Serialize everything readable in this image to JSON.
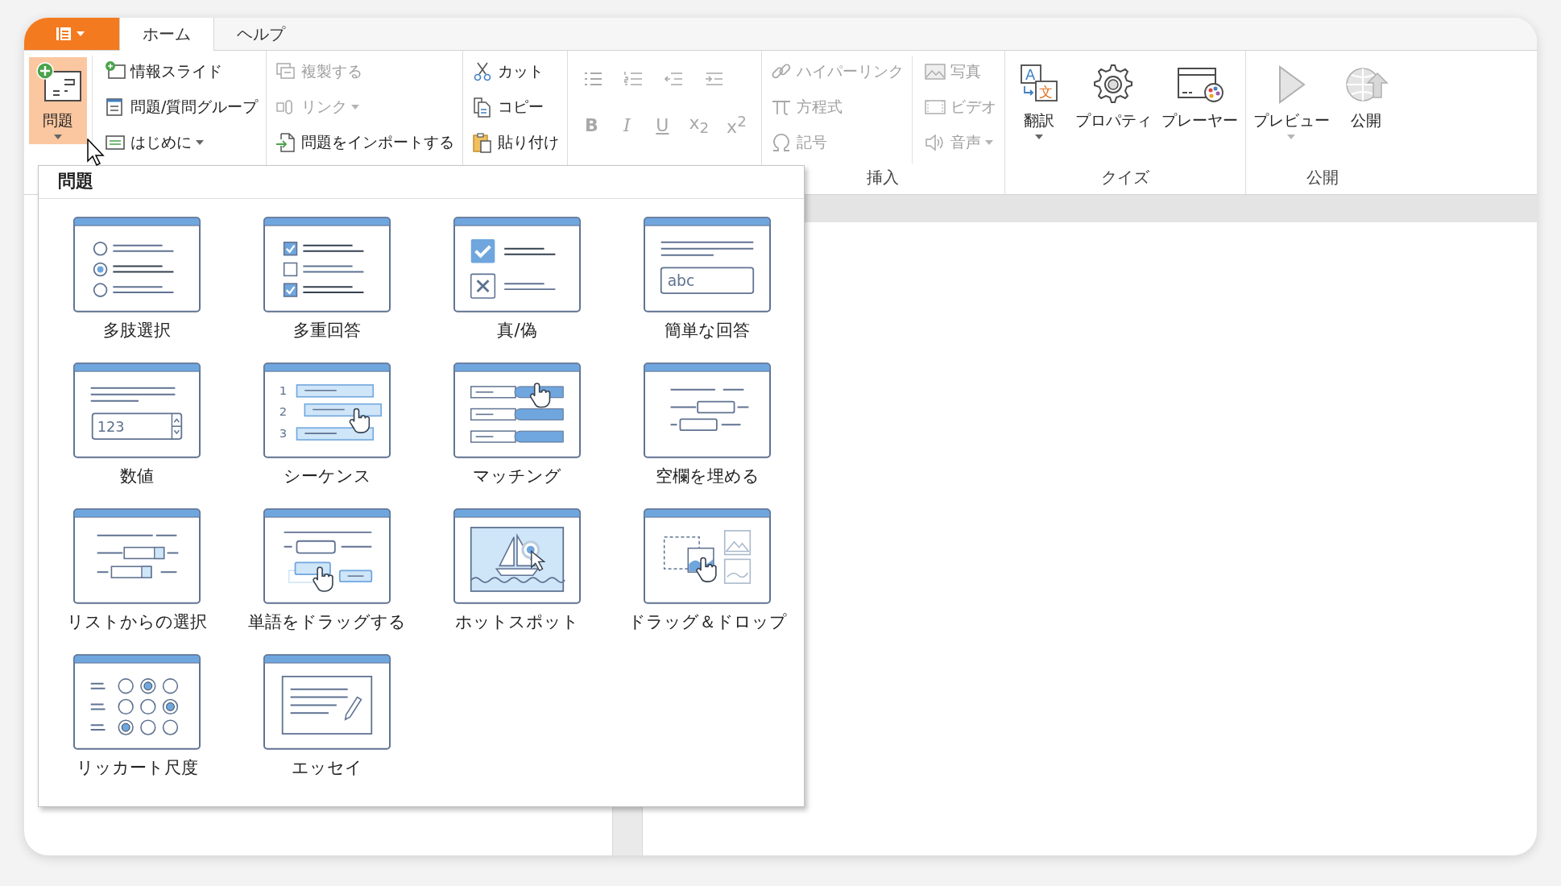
{
  "tabs": [
    {
      "label": "ホーム",
      "selected": true
    },
    {
      "label": "ヘルプ",
      "selected": false
    }
  ],
  "ribbon": {
    "groups": [
      {
        "items": [
          {
            "kind": "large",
            "label": "問題",
            "dropdown": true,
            "pressed": true,
            "disabled": false
          },
          {
            "kind": "small",
            "label": "情報スライド",
            "dropdown": false,
            "disabled": false
          },
          {
            "kind": "small",
            "label": "問題/質問グループ",
            "dropdown": false,
            "disabled": false
          },
          {
            "kind": "small",
            "label": "はじめに",
            "dropdown": true,
            "disabled": false
          }
        ]
      },
      {
        "items": [
          {
            "kind": "small",
            "label": "複製する",
            "dropdown": false,
            "disabled": true
          },
          {
            "kind": "small",
            "label": "リンク",
            "dropdown": true,
            "disabled": true
          },
          {
            "kind": "small",
            "label": "問題をインポートする",
            "dropdown": false,
            "disabled": false
          }
        ]
      },
      {
        "items": [
          {
            "kind": "small",
            "label": "カット",
            "dropdown": false,
            "disabled": false
          },
          {
            "kind": "small",
            "label": "コピー",
            "dropdown": false,
            "disabled": false
          },
          {
            "kind": "small",
            "label": "貼り付け",
            "dropdown": false,
            "disabled": false
          }
        ]
      },
      {
        "rows": [
          [
            {
              "kind": "tool",
              "disabled": true
            },
            {
              "kind": "tool",
              "disabled": true
            },
            {
              "kind": "tool",
              "disabled": true
            },
            {
              "kind": "tool",
              "disabled": true
            }
          ],
          [
            {
              "kind": "tool",
              "label": "B",
              "disabled": true
            },
            {
              "kind": "tool",
              "label": "I",
              "disabled": true
            },
            {
              "kind": "tool",
              "label": "U",
              "disabled": true
            },
            {
              "kind": "tool",
              "label": "x$_{2}$",
              "disabled": true
            },
            {
              "kind": "tool",
              "label": "x$^{2}$",
              "disabled": true
            }
          ]
        ]
      },
      {
        "label": "挿入",
        "items": [
          {
            "kind": "small",
            "label": "ハイパーリンク",
            "dropdown": false,
            "disabled": true
          },
          {
            "kind": "small",
            "label": "方程式",
            "dropdown": false,
            "disabled": true
          },
          {
            "kind": "small",
            "label": "記号",
            "dropdown": false,
            "disabled": true
          },
          {
            "kind": "small",
            "label": "写真",
            "dropdown": false,
            "disabled": true
          },
          {
            "kind": "small",
            "label": "ビデオ",
            "dropdown": false,
            "disabled": true
          },
          {
            "kind": "small",
            "label": "音声",
            "dropdown": true,
            "disabled": true
          }
        ]
      },
      {
        "label": "クイズ",
        "items": [
          {
            "kind": "large",
            "label": "翻訳",
            "icon_text": [
              "A",
              "文"
            ],
            "dropdown": true,
            "pressed": false,
            "disabled": false
          },
          {
            "kind": "large",
            "label": "プロパティ",
            "dropdown": false,
            "pressed": false,
            "disabled": false
          },
          {
            "kind": "large",
            "label": "プレーヤー",
            "dropdown": false,
            "pressed": false,
            "disabled": false
          }
        ]
      },
      {
        "label": "公開",
        "items": [
          {
            "kind": "large",
            "label": "プレビュー",
            "dropdown": true,
            "pressed": false,
            "disabled": true
          },
          {
            "kind": "large",
            "label": "公開",
            "dropdown": false,
            "pressed": false,
            "disabled": true
          }
        ]
      }
    ]
  },
  "dropdown": {
    "title": "問題",
    "items": [
      {
        "label": "多肢選択"
      },
      {
        "label": "多重回答"
      },
      {
        "label": "真/偽"
      },
      {
        "label": "簡単な回答",
        "sample": "abc"
      },
      {
        "label": "数値",
        "sample": "123"
      },
      {
        "label": "シーケンス",
        "markers": [
          "1",
          "2",
          "3"
        ]
      },
      {
        "label": "マッチング"
      },
      {
        "label": "空欄を埋める"
      },
      {
        "label": "リストからの選択"
      },
      {
        "label": "単語をドラッグする"
      },
      {
        "label": "ホットスポット"
      },
      {
        "label": "ドラッグ＆ドロップ"
      },
      {
        "label": "リッカート尺度"
      },
      {
        "label": "エッセイ"
      }
    ]
  }
}
